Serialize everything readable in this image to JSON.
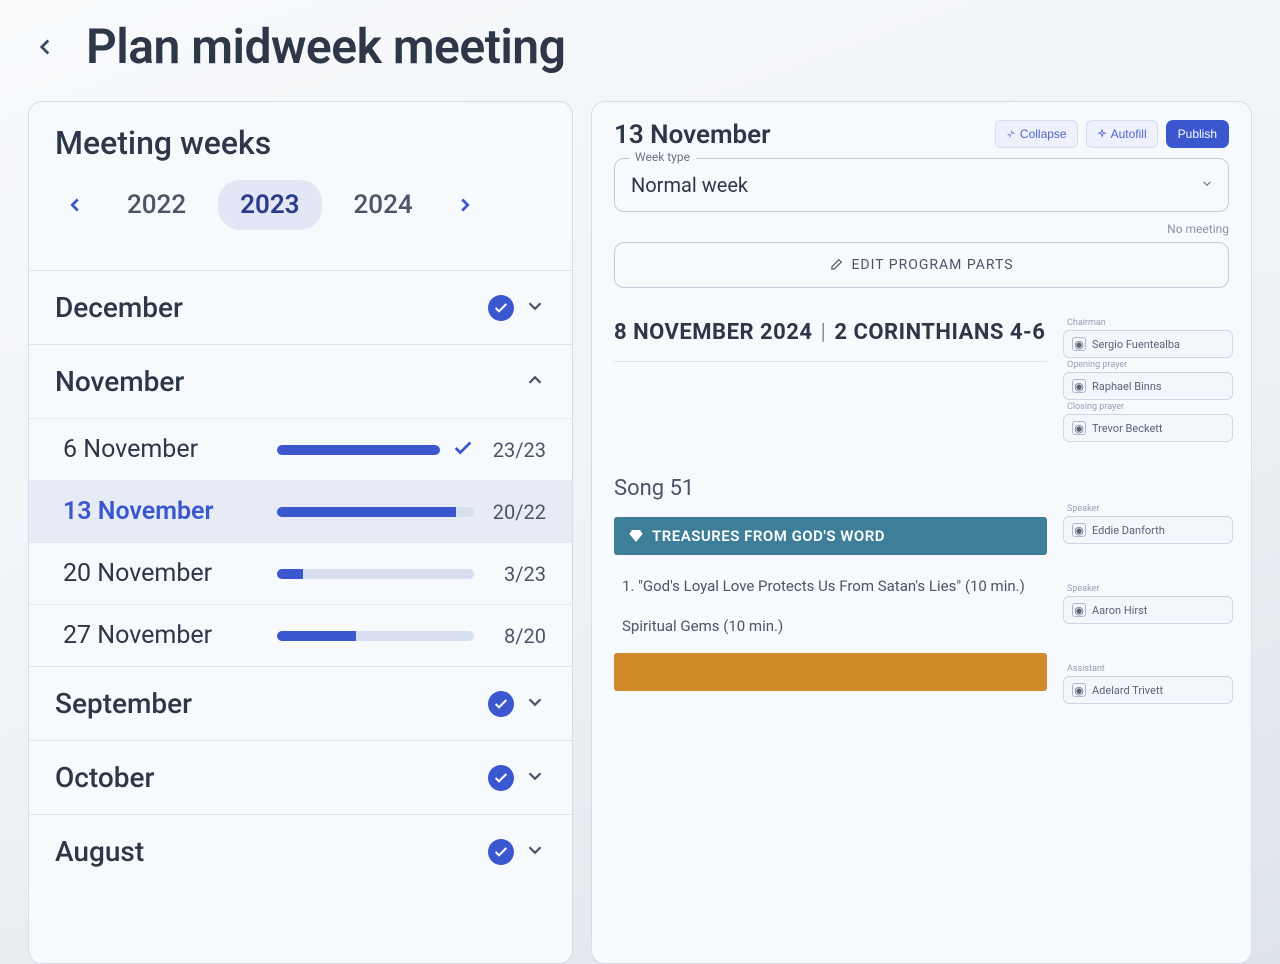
{
  "header": {
    "title": "Plan midweek meeting"
  },
  "weeksPanel": {
    "title": "Meeting weeks",
    "years": [
      "2022",
      "2023",
      "2024"
    ],
    "selectedYearIndex": 1,
    "months": [
      {
        "name": "December",
        "complete": true,
        "expanded": false
      },
      {
        "name": "November",
        "complete": false,
        "expanded": true,
        "weeks": [
          {
            "label": "6 November",
            "done": 23,
            "total": 23,
            "complete": true,
            "selected": false
          },
          {
            "label": "13 November",
            "done": 20,
            "total": 22,
            "complete": false,
            "selected": true
          },
          {
            "label": "20 November",
            "done": 3,
            "total": 23,
            "complete": false,
            "selected": false
          },
          {
            "label": "27 November",
            "done": 8,
            "total": 20,
            "complete": false,
            "selected": false
          }
        ]
      },
      {
        "name": "September",
        "complete": true,
        "expanded": false
      },
      {
        "name": "October",
        "complete": true,
        "expanded": false
      },
      {
        "name": "August",
        "complete": true,
        "expanded": false
      }
    ]
  },
  "detail": {
    "date": "13 November",
    "weekTypeLabel": "Week type",
    "weekTypeValue": "Normal week",
    "noMeeting": "No meeting",
    "editPartsLabel": "EDIT PROGRAM PARTS",
    "actions": {
      "collapse": "Collapse",
      "autofill": "Autofill",
      "publish": "Publish"
    },
    "schedule": {
      "dateLine": "8 NOVEMBER 2024",
      "reading": "2 CORINTHIANS 4-6",
      "song": "Song 51",
      "treasuresBanner": "TREASURES FROM GOD'S WORD",
      "part1": "1. \"God's Loyal Love Protects Us From Satan's Lies\" (10 min.)",
      "part2": "Spiritual Gems (10 min.)"
    },
    "assignments": {
      "chairman": {
        "label": "Chairman",
        "value": "Sergio Fuentealba"
      },
      "prayer1": {
        "label": "Opening prayer",
        "value": "Raphael Binns"
      },
      "prayer2": {
        "label": "Closing prayer",
        "value": "Trevor Beckett"
      },
      "part1": {
        "label": "Speaker",
        "value": "Eddie Danforth"
      },
      "part2": {
        "label": "Speaker",
        "value": "Aaron Hirst"
      },
      "part3": {
        "label": "Assistant",
        "value": "Adelard Trivett"
      }
    }
  }
}
